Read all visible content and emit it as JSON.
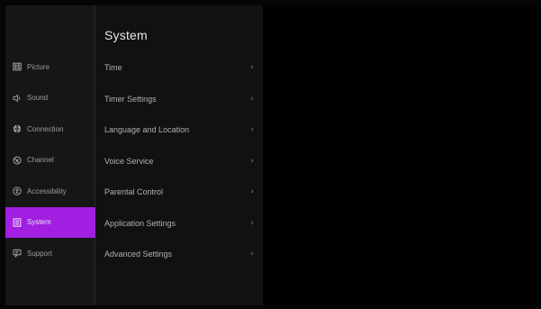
{
  "sidebar": {
    "items": [
      {
        "label": "Picture",
        "icon": "picture-icon"
      },
      {
        "label": "Sound",
        "icon": "sound-icon"
      },
      {
        "label": "Connection",
        "icon": "globe-icon"
      },
      {
        "label": "Channel",
        "icon": "satellite-icon"
      },
      {
        "label": "Accessibility",
        "icon": "accessibility-icon"
      },
      {
        "label": "System",
        "icon": "system-icon",
        "active": true
      },
      {
        "label": "Support",
        "icon": "chat-icon"
      }
    ]
  },
  "panel": {
    "title": "System",
    "items": [
      {
        "label": "Time"
      },
      {
        "label": "Timer Settings"
      },
      {
        "label": "Language and Location"
      },
      {
        "label": "Voice Service"
      },
      {
        "label": "Parental Control"
      },
      {
        "label": "Application Settings"
      },
      {
        "label": "Advanced Settings"
      }
    ],
    "chevron": "›"
  },
  "colors": {
    "accent": "#a21ee0",
    "background": "#000000",
    "sidebar": "#161618",
    "panel": "#111113"
  }
}
